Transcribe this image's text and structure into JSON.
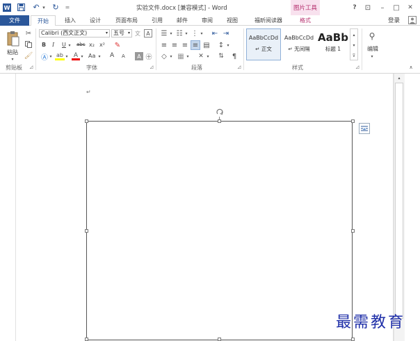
{
  "window": {
    "title": "实验文件.docx [兼容模式] - Word",
    "picture_tools": "图片工具",
    "sign_in": "登录",
    "help": "?",
    "minimize": "–",
    "restore": "□",
    "close": "✕",
    "ribbon_opts": "⊡",
    "undo_more": "▾",
    "qa_more": "="
  },
  "tabs": {
    "file": "文件",
    "home": "开始",
    "insert": "插入",
    "design": "设计",
    "layout": "页面布局",
    "references": "引用",
    "mailings": "邮件",
    "review": "审阅",
    "view": "视图",
    "foxit": "福昕阅读器",
    "format": "格式"
  },
  "ribbon": {
    "clipboard": {
      "paste": "粘贴",
      "label": "剪贴板"
    },
    "font": {
      "font_name": "Calibri (西文正文)",
      "font_size": "五号",
      "bold": "B",
      "italic": "I",
      "underline": "U",
      "strike": "abc",
      "sub": "x₂",
      "sup": "x²",
      "grow": "A",
      "shrink": "A",
      "change_case": "Aa",
      "clear": "A",
      "label": "字体"
    },
    "paragraph": {
      "label": "段落"
    },
    "styles": {
      "items": [
        {
          "preview": "AaBbCcDd",
          "name": "↵ 正文"
        },
        {
          "preview": "AaBbCcDd",
          "name": "↵ 无间隔"
        },
        {
          "preview": "AaBb",
          "name": "标题 1"
        }
      ],
      "label": "样式"
    },
    "editing": {
      "label": "编辑"
    }
  },
  "document": {
    "para_mark": "↵"
  },
  "watermark": "最需教育"
}
